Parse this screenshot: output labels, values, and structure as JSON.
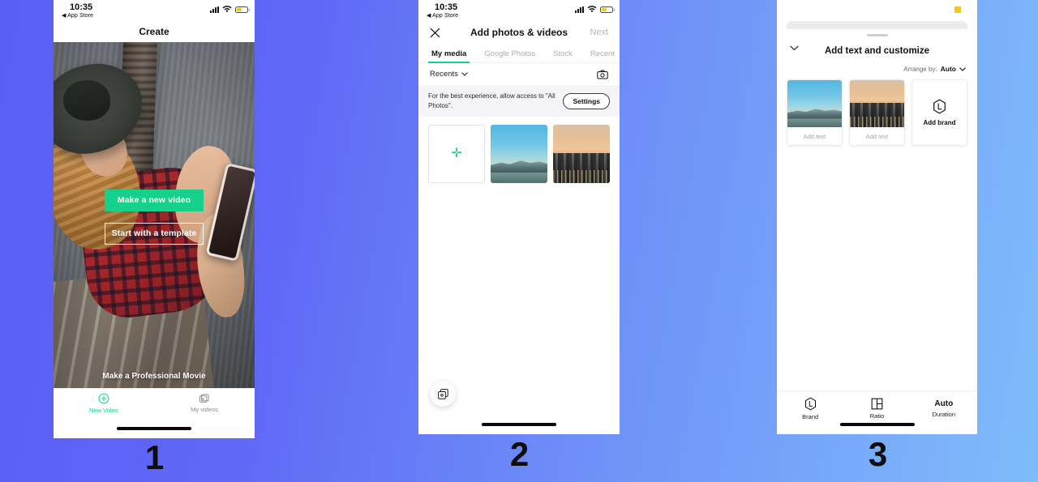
{
  "background": {
    "gradient_from": "#5a5ef5",
    "gradient_to": "#7fbcfb"
  },
  "accent": {
    "green": "#16d18c",
    "battery_yellow": "#f6c61d"
  },
  "steps": {
    "one": "1",
    "two": "2",
    "three": "3"
  },
  "status_bar": {
    "time": "10:35",
    "back_app": "◀ App Store"
  },
  "screen1": {
    "title": "Create",
    "hero": {
      "primary_button": "Make a new video",
      "secondary_button": "Start with a template",
      "caption": "Make a Professional Movie"
    },
    "tabs": [
      {
        "label": "New Video",
        "icon": "plus-circle-icon",
        "active": true
      },
      {
        "label": "My videos",
        "icon": "video-stack-icon",
        "active": false
      }
    ]
  },
  "screen2": {
    "nav": {
      "close_icon": "close-icon",
      "title": "Add photos & videos",
      "next": "Next"
    },
    "tabs": [
      {
        "label": "My media",
        "active": true
      },
      {
        "label": "Google Photos",
        "active": false
      },
      {
        "label": "Stock",
        "active": false
      },
      {
        "label": "Recent",
        "active": false
      }
    ],
    "filter": {
      "label": "Recents",
      "chevron": "chevron-down-icon",
      "camera_icon": "camera-icon"
    },
    "banner": {
      "text": "For the best experience, allow access to \"All Photos\".",
      "button": "Settings"
    },
    "grid": [
      {
        "type": "add",
        "icon": "plus-icon",
        "label": ""
      },
      {
        "type": "photo",
        "name": "sky-mountain-photo"
      },
      {
        "type": "photo",
        "name": "sunset-cityscape-photo"
      }
    ],
    "fab": {
      "icon": "photo-stack-icon"
    }
  },
  "screen3": {
    "sheet": {
      "chevron": "chevron-down-icon",
      "title": "Add text and customize"
    },
    "arrange": {
      "label": "Arrange by:",
      "value": "Auto",
      "chevron": "chevron-down-icon"
    },
    "cards": [
      {
        "type": "photo",
        "name": "sky-mountain-photo",
        "caption": "Add text"
      },
      {
        "type": "photo",
        "name": "sunset-cityscape-photo",
        "caption": "Add text"
      },
      {
        "type": "brand",
        "icon": "hexagon-l-logo-icon",
        "label": "Add brand"
      }
    ],
    "toolbar": [
      {
        "label": "Brand",
        "icon": "hexagon-l-logo-icon",
        "value": ""
      },
      {
        "label": "Ratio",
        "icon": "aspect-ratio-icon",
        "value": ""
      },
      {
        "label": "Duration",
        "icon": "",
        "value": "Auto"
      }
    ]
  }
}
